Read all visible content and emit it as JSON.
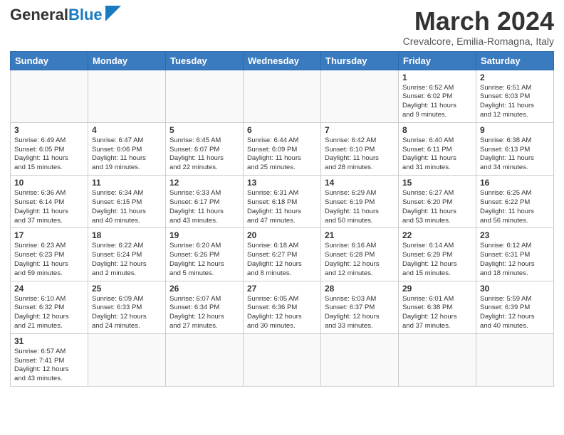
{
  "header": {
    "logo_general": "General",
    "logo_blue": "Blue",
    "month_year": "March 2024",
    "location": "Crevalcore, Emilia-Romagna, Italy"
  },
  "weekdays": [
    "Sunday",
    "Monday",
    "Tuesday",
    "Wednesday",
    "Thursday",
    "Friday",
    "Saturday"
  ],
  "weeks": [
    [
      {
        "num": "",
        "info": ""
      },
      {
        "num": "",
        "info": ""
      },
      {
        "num": "",
        "info": ""
      },
      {
        "num": "",
        "info": ""
      },
      {
        "num": "",
        "info": ""
      },
      {
        "num": "1",
        "info": "Sunrise: 6:52 AM\nSunset: 6:02 PM\nDaylight: 11 hours\nand 9 minutes."
      },
      {
        "num": "2",
        "info": "Sunrise: 6:51 AM\nSunset: 6:03 PM\nDaylight: 11 hours\nand 12 minutes."
      }
    ],
    [
      {
        "num": "3",
        "info": "Sunrise: 6:49 AM\nSunset: 6:05 PM\nDaylight: 11 hours\nand 15 minutes."
      },
      {
        "num": "4",
        "info": "Sunrise: 6:47 AM\nSunset: 6:06 PM\nDaylight: 11 hours\nand 19 minutes."
      },
      {
        "num": "5",
        "info": "Sunrise: 6:45 AM\nSunset: 6:07 PM\nDaylight: 11 hours\nand 22 minutes."
      },
      {
        "num": "6",
        "info": "Sunrise: 6:44 AM\nSunset: 6:09 PM\nDaylight: 11 hours\nand 25 minutes."
      },
      {
        "num": "7",
        "info": "Sunrise: 6:42 AM\nSunset: 6:10 PM\nDaylight: 11 hours\nand 28 minutes."
      },
      {
        "num": "8",
        "info": "Sunrise: 6:40 AM\nSunset: 6:11 PM\nDaylight: 11 hours\nand 31 minutes."
      },
      {
        "num": "9",
        "info": "Sunrise: 6:38 AM\nSunset: 6:13 PM\nDaylight: 11 hours\nand 34 minutes."
      }
    ],
    [
      {
        "num": "10",
        "info": "Sunrise: 6:36 AM\nSunset: 6:14 PM\nDaylight: 11 hours\nand 37 minutes."
      },
      {
        "num": "11",
        "info": "Sunrise: 6:34 AM\nSunset: 6:15 PM\nDaylight: 11 hours\nand 40 minutes."
      },
      {
        "num": "12",
        "info": "Sunrise: 6:33 AM\nSunset: 6:17 PM\nDaylight: 11 hours\nand 43 minutes."
      },
      {
        "num": "13",
        "info": "Sunrise: 6:31 AM\nSunset: 6:18 PM\nDaylight: 11 hours\nand 47 minutes."
      },
      {
        "num": "14",
        "info": "Sunrise: 6:29 AM\nSunset: 6:19 PM\nDaylight: 11 hours\nand 50 minutes."
      },
      {
        "num": "15",
        "info": "Sunrise: 6:27 AM\nSunset: 6:20 PM\nDaylight: 11 hours\nand 53 minutes."
      },
      {
        "num": "16",
        "info": "Sunrise: 6:25 AM\nSunset: 6:22 PM\nDaylight: 11 hours\nand 56 minutes."
      }
    ],
    [
      {
        "num": "17",
        "info": "Sunrise: 6:23 AM\nSunset: 6:23 PM\nDaylight: 11 hours\nand 59 minutes."
      },
      {
        "num": "18",
        "info": "Sunrise: 6:22 AM\nSunset: 6:24 PM\nDaylight: 12 hours\nand 2 minutes."
      },
      {
        "num": "19",
        "info": "Sunrise: 6:20 AM\nSunset: 6:26 PM\nDaylight: 12 hours\nand 5 minutes."
      },
      {
        "num": "20",
        "info": "Sunrise: 6:18 AM\nSunset: 6:27 PM\nDaylight: 12 hours\nand 8 minutes."
      },
      {
        "num": "21",
        "info": "Sunrise: 6:16 AM\nSunset: 6:28 PM\nDaylight: 12 hours\nand 12 minutes."
      },
      {
        "num": "22",
        "info": "Sunrise: 6:14 AM\nSunset: 6:29 PM\nDaylight: 12 hours\nand 15 minutes."
      },
      {
        "num": "23",
        "info": "Sunrise: 6:12 AM\nSunset: 6:31 PM\nDaylight: 12 hours\nand 18 minutes."
      }
    ],
    [
      {
        "num": "24",
        "info": "Sunrise: 6:10 AM\nSunset: 6:32 PM\nDaylight: 12 hours\nand 21 minutes."
      },
      {
        "num": "25",
        "info": "Sunrise: 6:09 AM\nSunset: 6:33 PM\nDaylight: 12 hours\nand 24 minutes."
      },
      {
        "num": "26",
        "info": "Sunrise: 6:07 AM\nSunset: 6:34 PM\nDaylight: 12 hours\nand 27 minutes."
      },
      {
        "num": "27",
        "info": "Sunrise: 6:05 AM\nSunset: 6:36 PM\nDaylight: 12 hours\nand 30 minutes."
      },
      {
        "num": "28",
        "info": "Sunrise: 6:03 AM\nSunset: 6:37 PM\nDaylight: 12 hours\nand 33 minutes."
      },
      {
        "num": "29",
        "info": "Sunrise: 6:01 AM\nSunset: 6:38 PM\nDaylight: 12 hours\nand 37 minutes."
      },
      {
        "num": "30",
        "info": "Sunrise: 5:59 AM\nSunset: 6:39 PM\nDaylight: 12 hours\nand 40 minutes."
      }
    ],
    [
      {
        "num": "31",
        "info": "Sunrise: 6:57 AM\nSunset: 7:41 PM\nDaylight: 12 hours\nand 43 minutes."
      },
      {
        "num": "",
        "info": ""
      },
      {
        "num": "",
        "info": ""
      },
      {
        "num": "",
        "info": ""
      },
      {
        "num": "",
        "info": ""
      },
      {
        "num": "",
        "info": ""
      },
      {
        "num": "",
        "info": ""
      }
    ]
  ]
}
